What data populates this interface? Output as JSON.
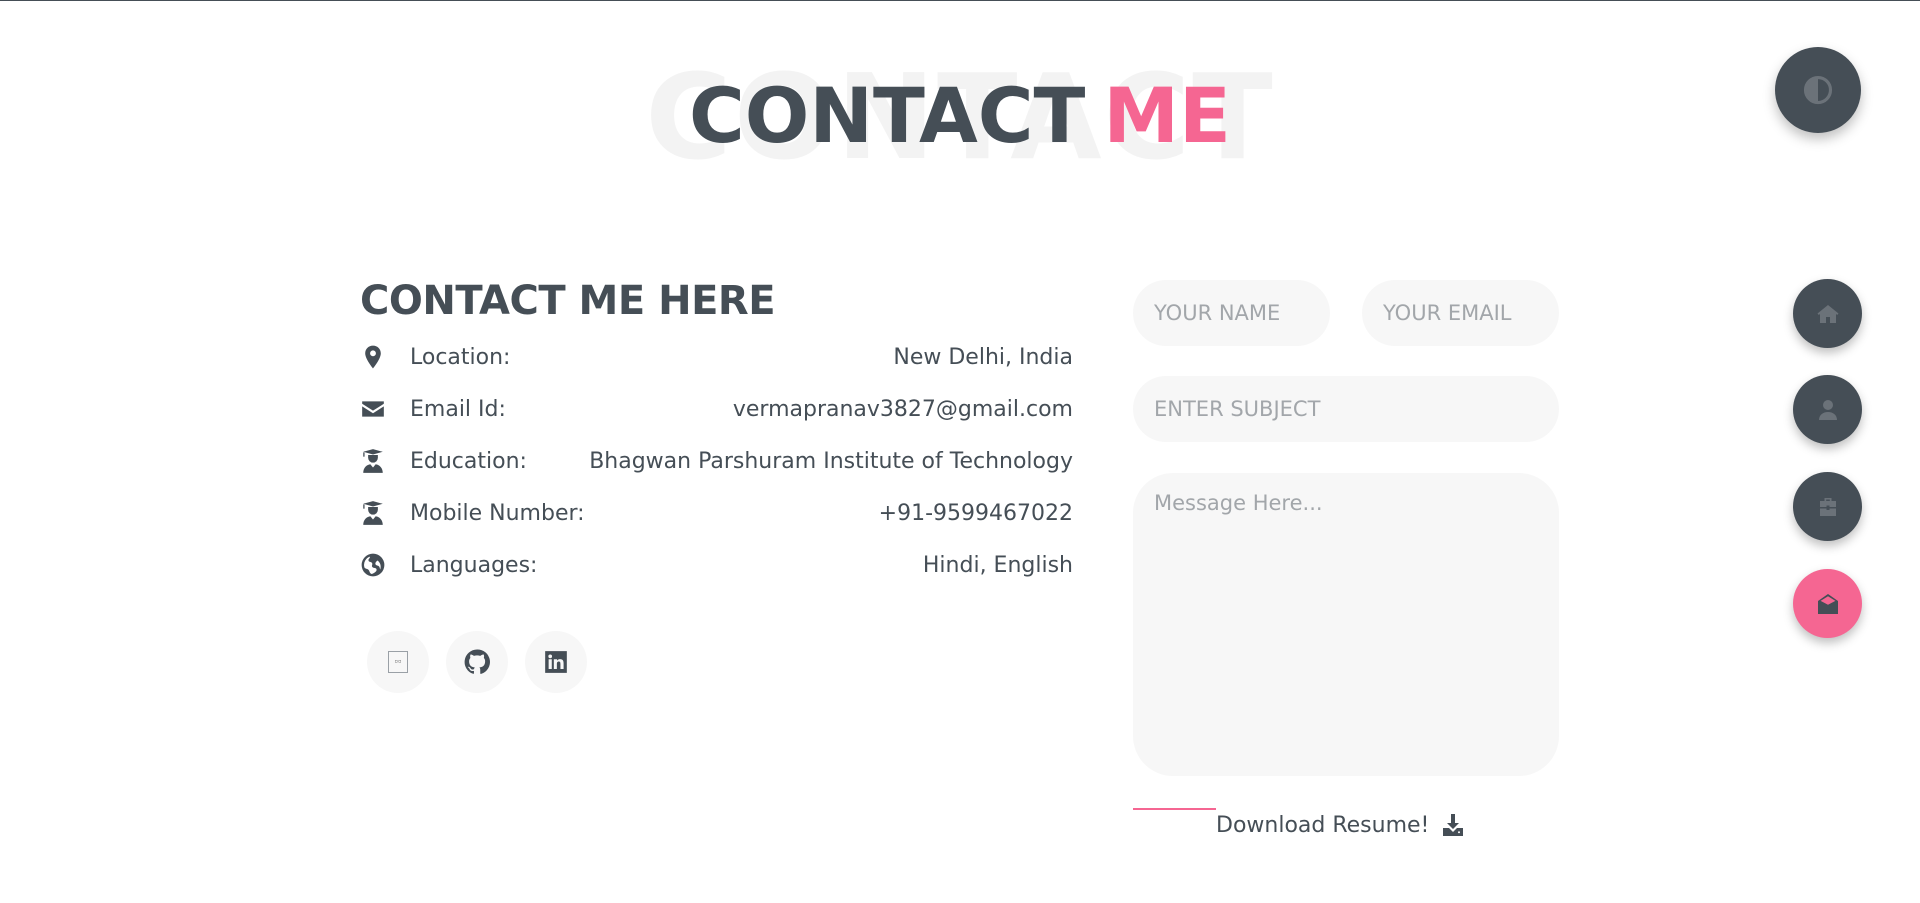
{
  "heading": {
    "background_word": "CONTACT",
    "word1": "CONTACT",
    "word2": "ME"
  },
  "contact_info": {
    "title": "CONTACT ME HERE",
    "rows": [
      {
        "icon": "map-marker-icon",
        "label": "Location:",
        "value": "New Delhi, India"
      },
      {
        "icon": "envelope-icon",
        "label": "Email Id:",
        "value": "vermapranav3827@gmail.com"
      },
      {
        "icon": "user-graduate-icon",
        "label": "Education:",
        "value": "Bhagwan Parshuram Institute of Technology"
      },
      {
        "icon": "user-graduate-icon",
        "label": "Mobile Number:",
        "value": "+91-9599467022"
      },
      {
        "icon": "globe-icon",
        "label": "Languages:",
        "value": "Hindi, English"
      }
    ],
    "socials": [
      {
        "icon": "broken-image-icon"
      },
      {
        "icon": "github-icon"
      },
      {
        "icon": "linkedin-icon"
      }
    ]
  },
  "form": {
    "name_placeholder": "YOUR NAME",
    "email_placeholder": "YOUR EMAIL",
    "subject_placeholder": "ENTER SUBJECT",
    "message_placeholder": "Message Here...",
    "download_label": "Download Resume!"
  },
  "nav": {
    "theme_icon": "half-circle-contrast-icon",
    "items": [
      {
        "icon": "home-icon",
        "active": false
      },
      {
        "icon": "user-icon",
        "active": false
      },
      {
        "icon": "briefcase-icon",
        "active": false
      },
      {
        "icon": "envelope-open-icon",
        "active": true
      }
    ]
  },
  "colors": {
    "text": "#454e56",
    "accent": "#f56692",
    "field_bg": "#f7f7f7",
    "background": "#ffffff"
  }
}
